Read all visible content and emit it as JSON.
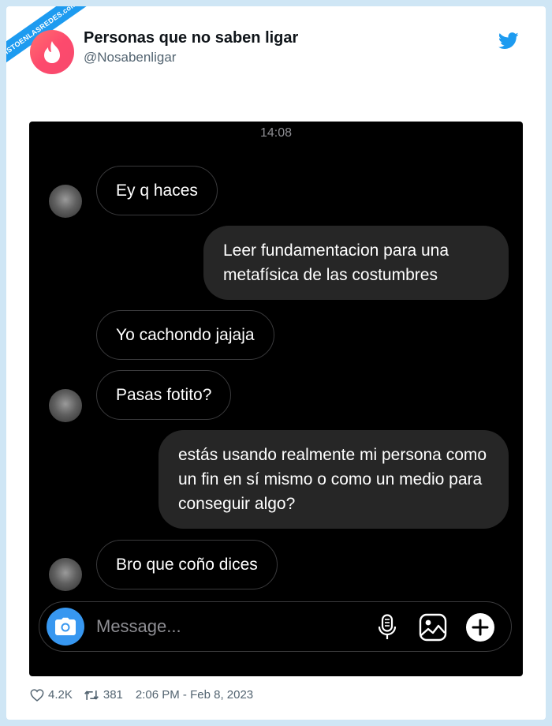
{
  "watermark": "VISTOENLASREDES.com",
  "tweet": {
    "display_name": "Personas que no saben ligar",
    "handle": "@Nosabenligar"
  },
  "chat": {
    "timestamp": "14:08",
    "messages": [
      {
        "from": "them",
        "text": "Ey q haces"
      },
      {
        "from": "me",
        "text": "Leer fundamentacion para una metafísica de las costumbres"
      },
      {
        "from": "them",
        "text": "Yo cachondo jajaja"
      },
      {
        "from": "them",
        "text": "Pasas fotito?"
      },
      {
        "from": "me",
        "text": "estás usando realmente mi persona como un fin en sí mismo o como un medio para conseguir algo?"
      },
      {
        "from": "them",
        "text": "Bro que coño dices"
      }
    ],
    "composer_placeholder": "Message...",
    "accent": "#3797f0"
  },
  "stats": {
    "likes": "4.2K",
    "retweets": "381",
    "datetime": "2:06 PM - Feb 8, 2023"
  },
  "colors": {
    "twitter_blue": "#1d9bf0",
    "page_bg": "#cfe6f5",
    "bubble_out": "#262626"
  }
}
